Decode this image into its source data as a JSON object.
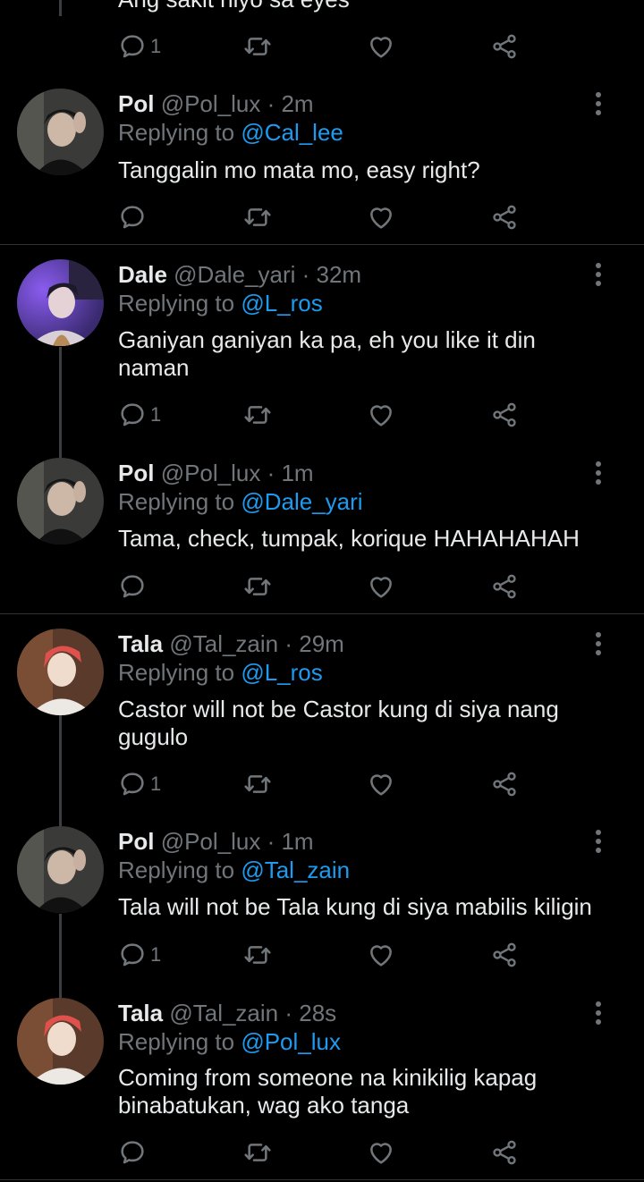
{
  "top_partial": {
    "text": "Ang sakit niyo sa eyes",
    "reply_count": "1"
  },
  "tweets": [
    {
      "name": "Pol",
      "handle": "@Pol_lux",
      "time": "2m",
      "replying_prefix": "Replying to ",
      "replying_to": "@Cal_lee",
      "text": "Tanggalin mo mata mo, easy right?",
      "reply_count": ""
    },
    {
      "name": "Dale",
      "handle": "@Dale_yari",
      "time": "32m",
      "replying_prefix": "Replying to ",
      "replying_to": "@L_ros",
      "text": "Ganiyan ganiyan ka pa, eh you like it din naman",
      "reply_count": "1"
    },
    {
      "name": "Pol",
      "handle": "@Pol_lux",
      "time": "1m",
      "replying_prefix": "Replying to ",
      "replying_to": "@Dale_yari",
      "text": "Tama, check, tumpak, korique HAHAHAHAH",
      "reply_count": ""
    },
    {
      "name": "Tala",
      "handle": "@Tal_zain",
      "time": "29m",
      "replying_prefix": "Replying to ",
      "replying_to": "@L_ros",
      "text": "Castor will not be Castor kung di siya nang gugulo",
      "reply_count": "1"
    },
    {
      "name": "Pol",
      "handle": "@Pol_lux",
      "time": "1m",
      "replying_prefix": "Replying to ",
      "replying_to": "@Tal_zain",
      "text": "Tala will not be Tala kung di siya mabilis kiligin",
      "reply_count": "1"
    },
    {
      "name": "Tala",
      "handle": "@Tal_zain",
      "time": "28s",
      "replying_prefix": "Replying to ",
      "replying_to": "@Pol_lux",
      "text": "Coming from someone na kinikilig kapag binabatukan, wag ako tanga",
      "reply_count": ""
    }
  ],
  "separator": " · ",
  "icons": {
    "reply": "reply-icon",
    "retweet": "retweet-icon",
    "like": "heart-icon",
    "share": "share-icon",
    "more": "more-vertical-icon"
  },
  "colors": {
    "background": "#000000",
    "text": "#e7e9ea",
    "muted": "#71767b",
    "link": "#1d9bf0",
    "divider": "#2f3336"
  }
}
